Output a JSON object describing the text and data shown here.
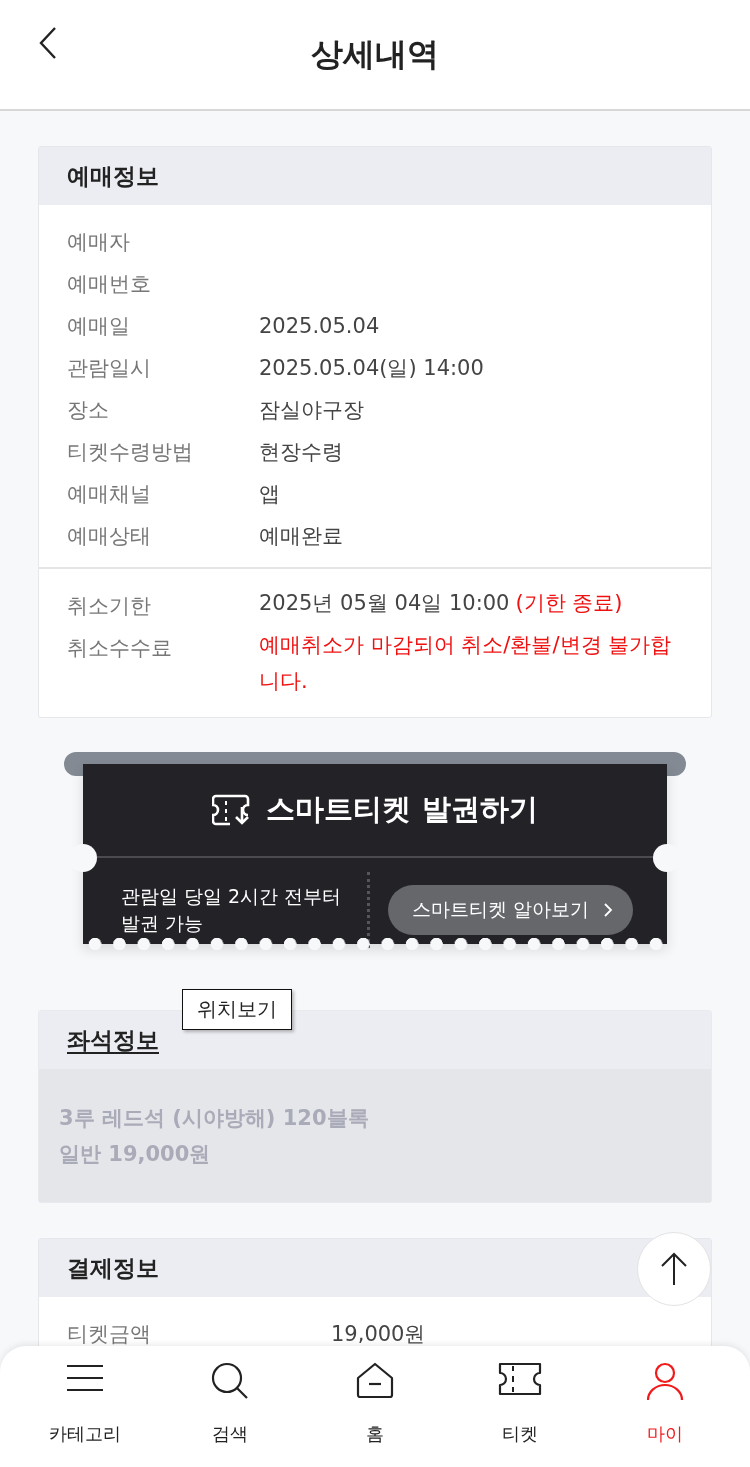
{
  "header": {
    "title": "상세내역"
  },
  "booking_info": {
    "title": "예매정보",
    "rows": [
      {
        "label": "예매자"
      },
      {
        "label": "예매번호"
      },
      {
        "label": "예매일",
        "value": "2025.05.04"
      },
      {
        "label": "관람일시",
        "value": "2025.05.04(일) 14:00"
      },
      {
        "label": "장소",
        "value": "잠실야구장"
      },
      {
        "label": "티켓수령방법",
        "value": "현장수령"
      },
      {
        "label": "예매채널",
        "value": "앱"
      },
      {
        "label": "예매상태",
        "value": "예매완료"
      }
    ],
    "cancel_rows": [
      {
        "label": "취소기한",
        "value": "2025년 05월 04일 10:00",
        "note": "(기한 종료)",
        "kind": "normal"
      },
      {
        "label": "취소수수료",
        "value": "예매취소가 마감되어 취소/환불/변경 불가합니다.",
        "kind": "warning"
      }
    ]
  },
  "smart_ticket": {
    "title": "스마트티켓 발권하기",
    "notice": "관람일 당일 2시간 전부터 발권 가능",
    "button": "스마트티켓 알아보기"
  },
  "seat_info": {
    "title": "좌석정보",
    "tooltip": "위치보기",
    "lines": [
      "3루 레드석 (시야방해) 120블록",
      "일반 19,000원"
    ]
  },
  "payment_info": {
    "title": "결제정보",
    "rows": [
      {
        "label": "티켓금액",
        "value": "19,000원"
      }
    ]
  },
  "nav": [
    {
      "kind": "menu",
      "label": "카테고리",
      "selected": false
    },
    {
      "kind": "search",
      "label": "검색",
      "selected": false
    },
    {
      "kind": "home",
      "label": "홈",
      "selected": false
    },
    {
      "kind": "ticket",
      "label": "티켓",
      "selected": false
    },
    {
      "kind": "my",
      "label": "마이",
      "selected": true
    }
  ]
}
